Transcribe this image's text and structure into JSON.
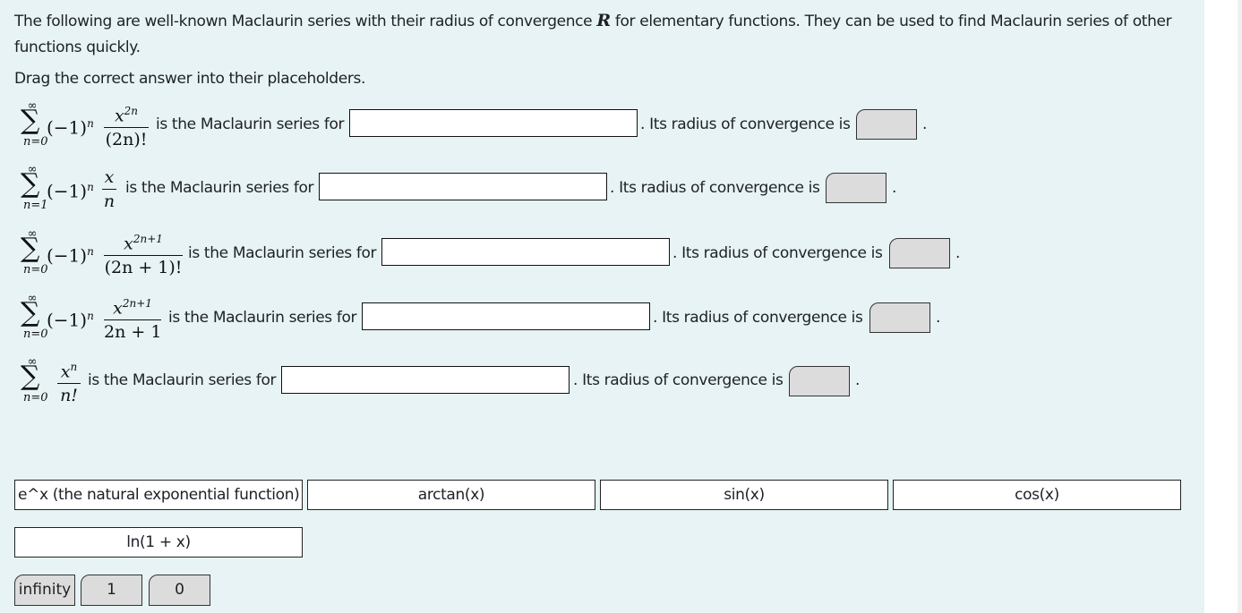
{
  "intro": {
    "text_before": "The following are well-known Maclaurin series with their radius of convergence ",
    "symbol": "R",
    "text_after": " for elementary functions. They can be used to find Maclaurin series of other functions quickly."
  },
  "instruction": "Drag the correct answer into their placeholders.",
  "rows": [
    {
      "sum_upper": "∞",
      "sum_lower": "n=0",
      "sign_factor": "(−1)",
      "sign_exp": "n",
      "num_base": "x",
      "num_exp": "2n",
      "denominator": "(2n)!",
      "phrase": "is the Maclaurin series for",
      "function_answer": "",
      "radius_phrase": ". Its radius of convergence is",
      "radius_answer": "",
      "end": "."
    },
    {
      "sum_upper": "∞",
      "sum_lower": "n=1",
      "sign_factor": "(−1)",
      "sign_exp": "n",
      "num_base": "x",
      "num_exp": "",
      "denominator": "n",
      "phrase": "is the Maclaurin series for",
      "function_answer": "",
      "radius_phrase": ". Its radius of convergence is",
      "radius_answer": "",
      "end": "."
    },
    {
      "sum_upper": "∞",
      "sum_lower": "n=0",
      "sign_factor": "(−1)",
      "sign_exp": "n",
      "num_base": "x",
      "num_exp": "2n+1",
      "denominator": "(2n + 1)!",
      "phrase": "is the Maclaurin series for",
      "function_answer": "",
      "radius_phrase": ". Its radius of convergence is",
      "radius_answer": "",
      "end": "."
    },
    {
      "sum_upper": "∞",
      "sum_lower": "n=0",
      "sign_factor": "(−1)",
      "sign_exp": "n",
      "num_base": "x",
      "num_exp": "2n+1",
      "denominator": "2n + 1",
      "phrase": "is the Maclaurin series for",
      "function_answer": "",
      "radius_phrase": ". Its radius of convergence is",
      "radius_answer": "",
      "end": "."
    },
    {
      "sum_upper": "∞",
      "sum_lower": "n=0",
      "sign_factor": "",
      "sign_exp": "",
      "num_base": "x",
      "num_exp": "n",
      "denominator": "n!",
      "phrase": "is the Maclaurin series for",
      "function_answer": "",
      "radius_phrase": ". Its radius of convergence is",
      "radius_answer": "",
      "end": "."
    }
  ],
  "function_choices": [
    "e^x (the natural exponential function)",
    "arctan(x)",
    "sin(x)",
    "cos(x)",
    "ln(1 + x)"
  ],
  "radius_choices": [
    "infinity",
    "1",
    "0"
  ],
  "colors": {
    "panel_bg": "#e7f3f5",
    "radius_chip_bg": "#dcdcdc",
    "function_chip_bg": "#ffffff"
  }
}
